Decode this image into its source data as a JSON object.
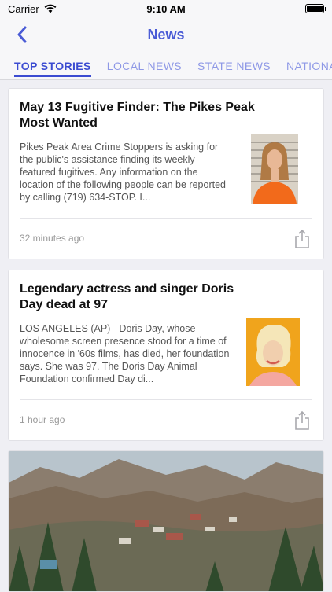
{
  "status_bar": {
    "carrier": "Carrier",
    "time": "9:10 AM"
  },
  "nav": {
    "title": "News"
  },
  "tabs": [
    {
      "label": "TOP STORIES",
      "active": true
    },
    {
      "label": "LOCAL NEWS",
      "active": false
    },
    {
      "label": "STATE NEWS",
      "active": false
    },
    {
      "label": "NATIONAL",
      "active": false
    }
  ],
  "stories": [
    {
      "title": "May 13 Fugitive Finder: The Pikes Peak Most Wanted",
      "summary": "Pikes Peak Area Crime Stoppers is asking for the public's assistance finding its weekly featured fugitives. Any information on the location of the following people can be reported by calling (719) 634-STOP. I...",
      "time": "32 minutes ago"
    },
    {
      "title": "Legendary actress and singer Doris Day dead at 97",
      "summary": "LOS ANGELES (AP) - Doris Day, whose wholesome screen presence stood for a time of innocence in '60s films, has died, her foundation says. She was 97. The Doris Day Animal Foundation confirmed Day di...",
      "time": "1 hour ago"
    }
  ],
  "colors": {
    "accent": "#3b4bd1",
    "tab_inactive": "#8e98e6",
    "background": "#efeff4"
  },
  "icons": {
    "back": "chevron-left-icon",
    "share": "share-icon",
    "wifi": "wifi-icon",
    "battery": "battery-icon"
  }
}
